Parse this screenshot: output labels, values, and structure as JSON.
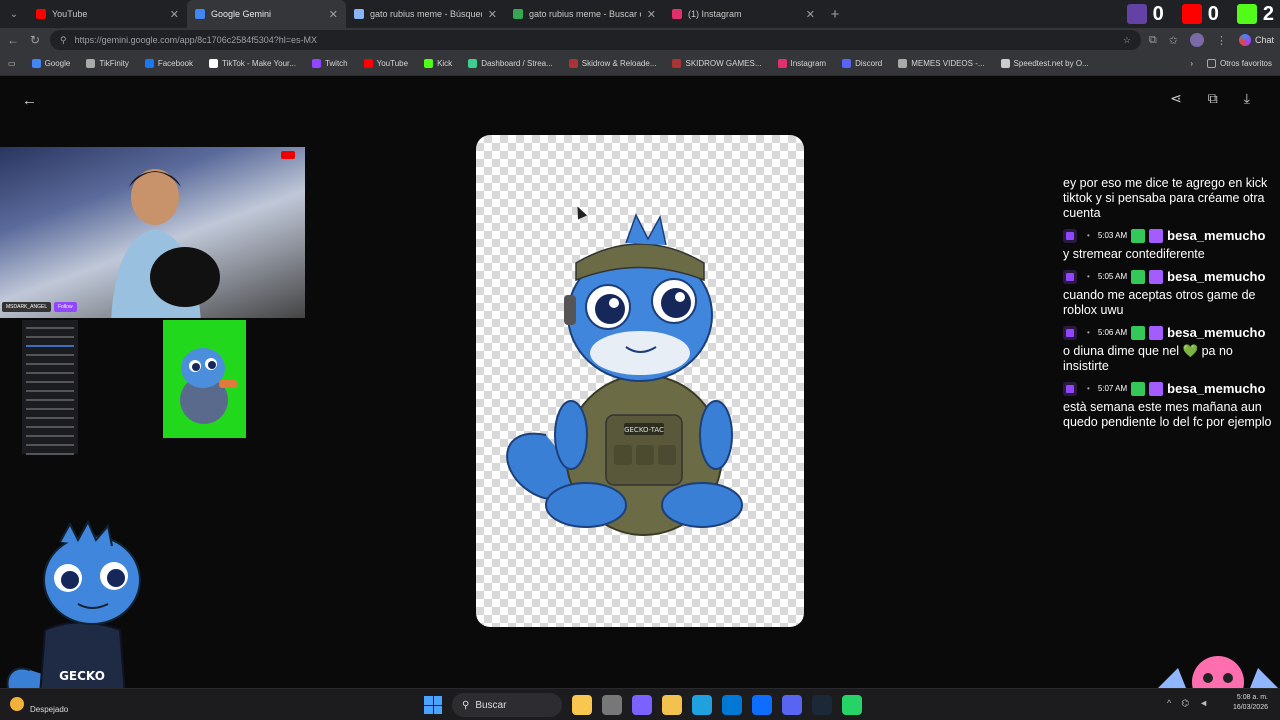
{
  "browser": {
    "tabs": [
      {
        "title": "YouTube",
        "color": "#ff0000",
        "active": false
      },
      {
        "title": "Google Gemini",
        "color": "#4285f4",
        "active": true
      },
      {
        "title": "gato rubius meme - Búsqueda",
        "color": "#8ab4f8",
        "active": false
      },
      {
        "title": "gato rubius meme - Buscar con Go",
        "color": "#34a853",
        "active": false
      },
      {
        "title": "(1) Instagram",
        "color": "#e1306c",
        "active": false
      }
    ],
    "stats": [
      {
        "platform": "twitch",
        "value": "0",
        "color": "#6441a5"
      },
      {
        "platform": "youtube",
        "value": "0",
        "color": "#ff0000"
      },
      {
        "platform": "kick",
        "value": "2",
        "color": "#53fc18"
      }
    ],
    "url": "https://gemini.google.com/app/8c1706c2584f5304?hl=es-MX",
    "chat_button": "Chat",
    "bookmarks": [
      {
        "label": "Google",
        "color": "#4285f4"
      },
      {
        "label": "TikFinity",
        "color": "#aaaaaa"
      },
      {
        "label": "Facebook",
        "color": "#1877f2"
      },
      {
        "label": "TikTok - Make Your...",
        "color": "#ffffff"
      },
      {
        "label": "Twitch",
        "color": "#9146ff"
      },
      {
        "label": "YouTube",
        "color": "#ff0000"
      },
      {
        "label": "Kick",
        "color": "#53fc18"
      },
      {
        "label": "Dashboard / Strea...",
        "color": "#3ecf8e"
      },
      {
        "label": "Skidrow & Reloade...",
        "color": "#a33"
      },
      {
        "label": "SKIDROW GAMES...",
        "color": "#a33"
      },
      {
        "label": "Instagram",
        "color": "#e1306c"
      },
      {
        "label": "Discord",
        "color": "#5865f2"
      },
      {
        "label": "MEMES VIDEOS -...",
        "color": "#aaaaaa"
      },
      {
        "label": "Speedtest.net by O...",
        "color": "#cccccc"
      }
    ],
    "other_bookmarks": "Otros favoritos"
  },
  "webcam": {
    "tag_name": "MSDARK_ANGEL",
    "tag_follow": "Follow"
  },
  "chat": {
    "messages": [
      {
        "text": "ey por eso me dice te agrego en kick tiktok y si pensaba para créame otra cuenta",
        "time": "",
        "user": ""
      },
      {
        "text": "y stremear contediferente",
        "time": "5:03 AM",
        "user": "besa_memucho"
      },
      {
        "text": "cuando me aceptas otros game de roblox uwu",
        "time": "5:05 AM",
        "user": "besa_memucho"
      },
      {
        "text": "o diuna dime que nel 💚 pa no insistirte",
        "time": "5:06 AM",
        "user": "besa_memucho"
      },
      {
        "text": "està semana este mes mañana aun quedo pendiente lo del fc por ejemplo",
        "time": "5:07 AM",
        "user": "besa_memucho"
      }
    ]
  },
  "taskbar": {
    "weather": "Despejado",
    "search_placeholder": "Buscar",
    "time": "5:08 a. m.",
    "date": "16/03/2026",
    "apps": [
      "#f9c74f",
      "#777777",
      "#7b61ff",
      "#f2c14e",
      "#1fa1e0",
      "#0078d4",
      "#0d6efd",
      "#5865f2",
      "#1b2838",
      "#25d366"
    ]
  }
}
